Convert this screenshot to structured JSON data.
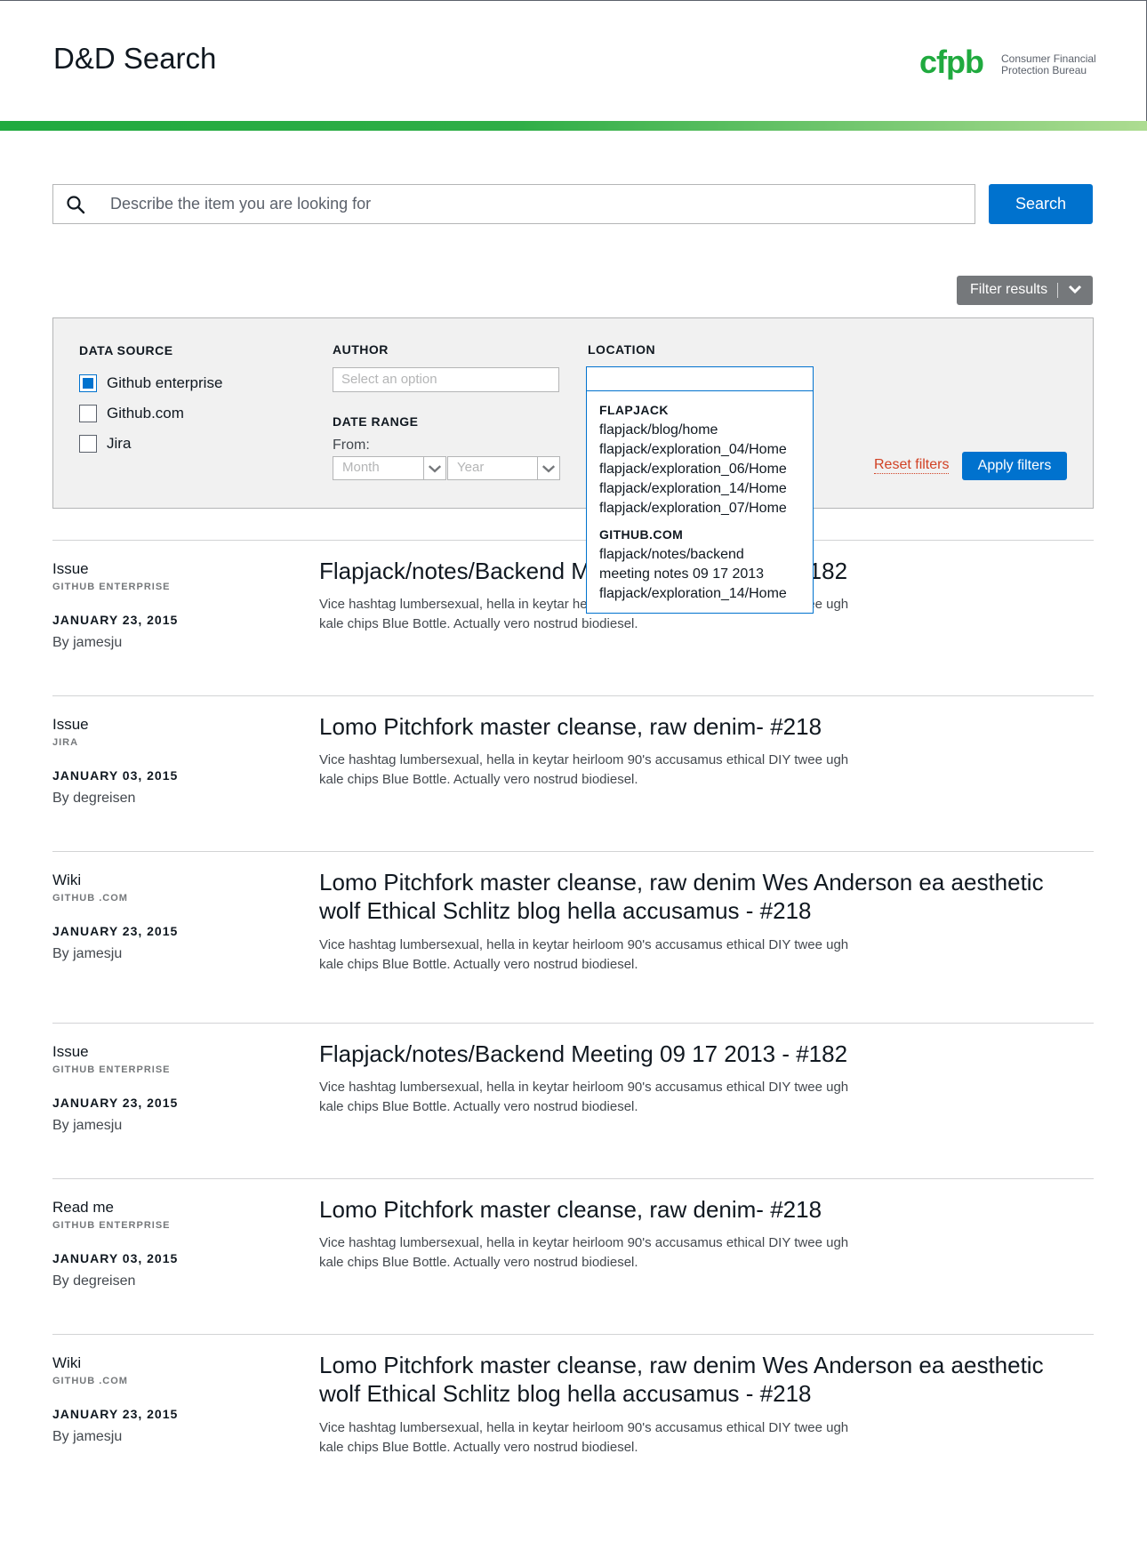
{
  "header": {
    "title": "D&D Search",
    "logo_mark": "cfpb",
    "logo_text_line1": "Consumer Financial",
    "logo_text_line2": "Protection Bureau",
    "brand_green": "#20aa3f"
  },
  "search": {
    "placeholder": "Describe the item you are looking for",
    "value": "",
    "button_label": "Search"
  },
  "filter_toggle": {
    "label": "Filter results",
    "icon": "chevron-down-icon"
  },
  "filters": {
    "data_source": {
      "heading": "DATA SOURCE",
      "options": [
        {
          "label": "Github enterprise",
          "checked": true
        },
        {
          "label": "Github.com",
          "checked": false
        },
        {
          "label": "Jira",
          "checked": false
        }
      ]
    },
    "author": {
      "heading": "AUTHOR",
      "placeholder": "Select an option"
    },
    "date_range": {
      "heading": "DATE RANGE",
      "from_label": "From:",
      "month_placeholder": "Month",
      "year_placeholder": "Year"
    },
    "location": {
      "heading": "LOCATION",
      "value": "",
      "dropdown_groups": [
        {
          "name": "FLAPJACK",
          "items": [
            "flapjack/blog/home",
            "flapjack/exploration_04/Home",
            "flapjack/exploration_06/Home",
            "flapjack/exploration_14/Home",
            "flapjack/exploration_07/Home"
          ]
        },
        {
          "name": "GITHUB.COM",
          "items": [
            "flapjack/notes/backend",
            "meeting notes 09 17 2013",
            "flapjack/exploration_14/Home"
          ]
        }
      ]
    },
    "reset_label": "Reset filters",
    "apply_label": "Apply filters"
  },
  "results": [
    {
      "type": "Issue",
      "source": "GITHUB ENTERPRISE",
      "date": "JANUARY 23, 2015",
      "author": "By jamesju",
      "title": "Flapjack/notes/Backend Meeting 09 17 2013 - #182",
      "desc_line1": "Vice hashtag lumbersexual, hella in keytar heirloom 90's accusamus ethical DIY twee ugh",
      "desc_line2": "kale chips Blue Bottle. Actually vero nostrud biodiesel."
    },
    {
      "type": "Issue",
      "source": "JIRA",
      "date": "JANUARY 03, 2015",
      "author": "By degreisen",
      "title": "Lomo Pitchfork master cleanse, raw denim- #218",
      "desc_line1": "Vice hashtag lumbersexual, hella in keytar heirloom 90's accusamus ethical DIY twee ugh",
      "desc_line2": "kale chips Blue Bottle. Actually vero nostrud biodiesel."
    },
    {
      "type": "Wiki",
      "source": "GITHUB .COM",
      "date": "JANUARY 23, 2015",
      "author": "By jamesju",
      "title_line1": "Lomo Pitchfork master cleanse, raw denim Wes Anderson ea aesthetic",
      "title_line2": "wolf Ethical Schlitz blog hella accusamus - #218",
      "desc_line1": "Vice hashtag lumbersexual, hella in keytar heirloom 90's accusamus ethical DIY twee ugh",
      "desc_line2": "kale chips Blue Bottle. Actually vero nostrud biodiesel."
    },
    {
      "type": "Issue",
      "source": "GITHUB ENTERPRISE",
      "date": "JANUARY 23, 2015",
      "author": "By jamesju",
      "title": "Flapjack/notes/Backend Meeting 09 17 2013 - #182",
      "desc_line1": "Vice hashtag lumbersexual, hella in keytar heirloom 90's accusamus ethical DIY twee ugh",
      "desc_line2": "kale chips Blue Bottle. Actually vero nostrud biodiesel."
    },
    {
      "type": "Read me",
      "source": "GITHUB ENTERPRISE",
      "date": "JANUARY 03, 2015",
      "author": "By degreisen",
      "title": "Lomo Pitchfork master cleanse, raw denim- #218",
      "desc_line1": "Vice hashtag lumbersexual, hella in keytar heirloom 90's accusamus ethical DIY twee ugh",
      "desc_line2": "kale chips Blue Bottle. Actually vero nostrud biodiesel."
    },
    {
      "type": "Wiki",
      "source": "GITHUB .COM",
      "date": "JANUARY 23, 2015",
      "author": "By jamesju",
      "title_line1": "Lomo Pitchfork master cleanse, raw denim Wes Anderson ea aesthetic",
      "title_line2": "wolf Ethical Schlitz blog hella accusamus - #218",
      "desc_line1": "Vice hashtag lumbersexual, hella in keytar heirloom 90's accusamus ethical DIY twee ugh",
      "desc_line2": "kale chips Blue Bottle. Actually vero nostrud biodiesel."
    }
  ]
}
